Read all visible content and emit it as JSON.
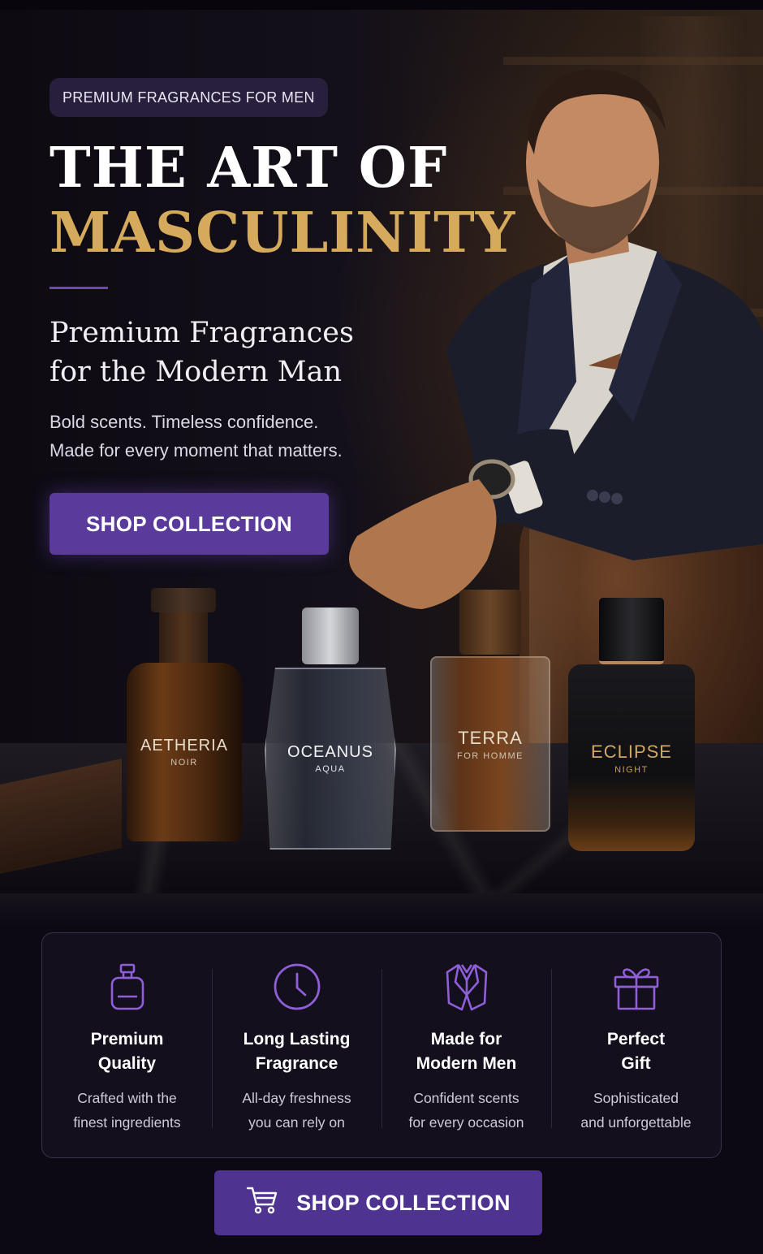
{
  "hero": {
    "badge": "PREMIUM FRAGRANCES FOR MEN",
    "title_line1": "THE ART OF",
    "title_line2": "MASCULINITY",
    "subtitle_line1": "Premium Fragrances",
    "subtitle_line2": "for the Modern Man",
    "tagline_line1": "Bold scents. Timeless confidence.",
    "tagline_line2": "Made for every moment that matters.",
    "cta_label": "SHOP COLLECTION"
  },
  "bottles": [
    {
      "name": "AETHERIA",
      "sub": "NOIR"
    },
    {
      "name": "OCEANUS",
      "sub": "AQUA"
    },
    {
      "name": "TERRA",
      "sub": "FOR HOMME"
    },
    {
      "name": "ECLIPSE",
      "sub": "NIGHT"
    }
  ],
  "features": [
    {
      "icon": "perfume-bottle-icon",
      "title_line1": "Premium",
      "title_line2": "Quality",
      "desc_line1": "Crafted with the",
      "desc_line2": "finest ingredients"
    },
    {
      "icon": "clock-icon",
      "title_line1": "Long Lasting",
      "title_line2": "Fragrance",
      "desc_line1": "All-day freshness",
      "desc_line2": "you can rely on"
    },
    {
      "icon": "suit-icon",
      "title_line1": "Made for",
      "title_line2": "Modern Men",
      "desc_line1": "Confident scents",
      "desc_line2": "for every occasion"
    },
    {
      "icon": "gift-icon",
      "title_line1": "Perfect",
      "title_line2": "Gift",
      "desc_line1": "Sophisticated",
      "desc_line2": "and unforgettable"
    }
  ],
  "bottom_cta": {
    "icon": "shopping-cart-icon",
    "label": "SHOP COLLECTION"
  },
  "colors": {
    "accent": "#5a3b9b",
    "gold": "#d6aa5d",
    "background": "#0c0914"
  }
}
